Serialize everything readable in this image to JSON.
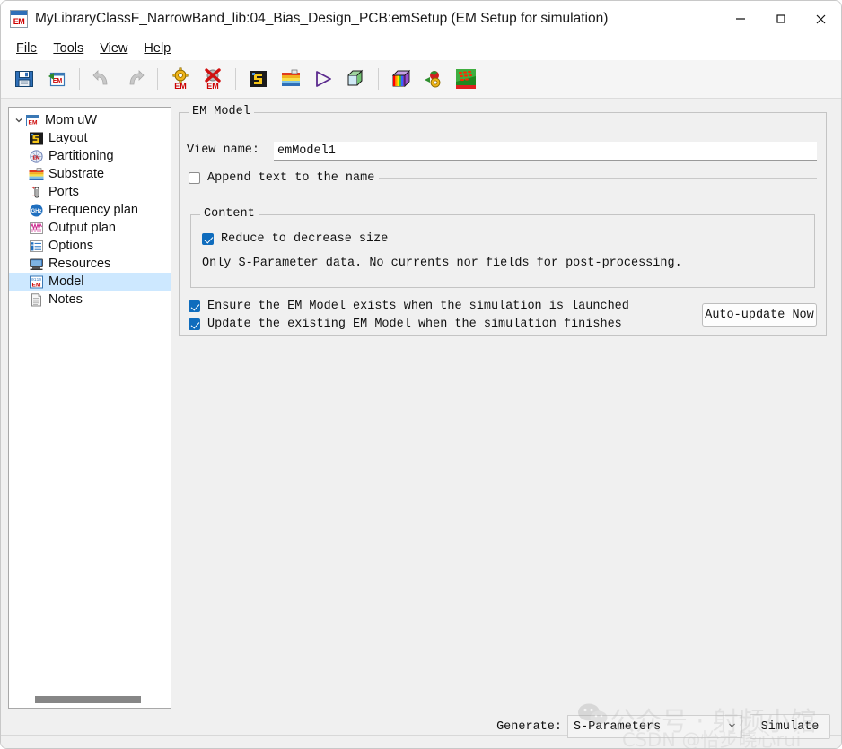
{
  "window": {
    "title": "MyLibraryClassF_NarrowBand_lib:04_Bias_Design_PCB:emSetup (EM Setup for simulation)",
    "app_icon": "em-icon",
    "icon_text": "EM",
    "controls": {
      "minimize": "minimize-icon",
      "maximize": "maximize-icon",
      "close": "close-icon"
    }
  },
  "menubar": {
    "items": [
      {
        "label": "File",
        "mnemonic": "F"
      },
      {
        "label": "Tools",
        "mnemonic": "T"
      },
      {
        "label": "View",
        "mnemonic": "V"
      },
      {
        "label": "Help",
        "mnemonic": "H"
      }
    ]
  },
  "toolbar": {
    "groups": [
      {
        "buttons": [
          {
            "name": "save-button",
            "icon": "floppy-disk-icon",
            "tooltip": "Save"
          },
          {
            "name": "save-em-setup-button",
            "icon": "save-em-icon",
            "tooltip": "Save EM Setup"
          }
        ]
      },
      {
        "buttons": [
          {
            "name": "undo-button",
            "icon": "undo-arrow-icon",
            "tooltip": "Undo"
          },
          {
            "name": "redo-button",
            "icon": "redo-arrow-icon",
            "tooltip": "Redo"
          }
        ]
      },
      {
        "buttons": [
          {
            "name": "em-settings-button",
            "icon": "gear-em-icon",
            "tooltip": "EM Settings"
          },
          {
            "name": "em-delete-button",
            "icon": "delete-em-icon",
            "tooltip": "Delete EM Setup"
          }
        ]
      },
      {
        "buttons": [
          {
            "name": "layout-button",
            "icon": "layout-icon",
            "tooltip": "Layout"
          },
          {
            "name": "substrate-button",
            "icon": "substrate-icon",
            "tooltip": "Substrate"
          },
          {
            "name": "simulate-button",
            "icon": "play-triangle-icon",
            "tooltip": "Simulate"
          },
          {
            "name": "mesh-cube-button",
            "icon": "wireframe-cube-icon",
            "tooltip": "Mesh"
          }
        ]
      },
      {
        "buttons": [
          {
            "name": "rainbow-cube-button",
            "icon": "rainbow-cube-icon",
            "tooltip": "3D View"
          },
          {
            "name": "em-cosim-button",
            "icon": "gear-ball-icon",
            "tooltip": "EM Cosimulation"
          },
          {
            "name": "current-visualization-button",
            "icon": "current-plot-icon",
            "tooltip": "Visualization"
          }
        ]
      }
    ]
  },
  "sidebar": {
    "root": {
      "label": "Mom uW",
      "icon": "em-icon",
      "expanded": true
    },
    "items": [
      {
        "label": "Layout",
        "icon": "layout-icon",
        "selected": false
      },
      {
        "label": "Partitioning",
        "icon": "partitioning-icon",
        "selected": false
      },
      {
        "label": "Substrate",
        "icon": "substrate-icon",
        "selected": false
      },
      {
        "label": "Ports",
        "icon": "ports-icon",
        "selected": false
      },
      {
        "label": "Frequency plan",
        "icon": "ghz-icon",
        "selected": false
      },
      {
        "label": "Output plan",
        "icon": "output-plan-icon",
        "selected": false
      },
      {
        "label": "Options",
        "icon": "options-list-icon",
        "selected": false
      },
      {
        "label": "Resources",
        "icon": "monitor-icon",
        "selected": false
      },
      {
        "label": "Model",
        "icon": "em-model-icon",
        "selected": true
      },
      {
        "label": "Notes",
        "icon": "document-icon",
        "selected": false
      }
    ],
    "scrollbar": {
      "name": "horizontal-scrollbar",
      "orientation": "horizontal"
    }
  },
  "main": {
    "group_title": "EM Model",
    "view_name": {
      "label": "View name:",
      "value": "emModel1",
      "placeholder": ""
    },
    "append_text": {
      "label": "Append text to the name",
      "checked": false
    },
    "content": {
      "group_title": "Content",
      "reduce": {
        "label": "Reduce to decrease size",
        "checked": true
      },
      "note": "Only S-Parameter data. No currents nor fields for post-processing."
    },
    "ensure": {
      "label": "Ensure the EM Model exists when the simulation is launched",
      "checked": true
    },
    "update": {
      "label": "Update the existing EM Model when the simulation finishes",
      "checked": true
    },
    "auto_update_button": "Auto-update Now"
  },
  "bottom": {
    "generate_label": "Generate:",
    "generate_value": "S-Parameters",
    "generate_caret": "chevron-down-icon",
    "simulate_label": "Simulate"
  },
  "watermark": {
    "line1": "公众号 · 射频小馆",
    "line2": "CSDN @怡步晓心rui",
    "logo": "wechat-icon"
  },
  "colors": {
    "accent": "#0f6cbd",
    "selection": "#cde8ff",
    "window_bg": "#f0f0f0",
    "panel_border": "#c4c4c4",
    "icon_red": "#cc0000",
    "icon_blue": "#2f6fb8"
  }
}
